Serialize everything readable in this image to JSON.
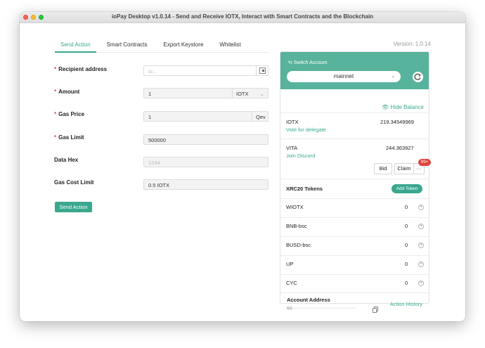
{
  "window": {
    "title": "ioPay Desktop v1.0.14 - Send and Receive IOTX, Interact with Smart Contracts and the Blockchain"
  },
  "tabs": [
    "Send Action",
    "Smart Contracts",
    "Export Keystore",
    "Whitelist"
  ],
  "version": "Version: 1.0.14",
  "form": {
    "recipient": {
      "label": "Recipient address",
      "placeholder": "io..."
    },
    "amount": {
      "label": "Amount",
      "value": "1",
      "unit": "IOTX"
    },
    "gas_price": {
      "label": "Gas Price",
      "value": "1",
      "unit": "Qev"
    },
    "gas_limit": {
      "label": "Gas Limit",
      "value": "500000"
    },
    "data_hex": {
      "label": "Data Hex",
      "placeholder": "1234"
    },
    "gas_cost": {
      "label": "Gas Cost Limit",
      "value": "0.5 IOTX"
    },
    "required_mark": "*",
    "send_label": "Send Action"
  },
  "account": {
    "switch_label": "Switch Account",
    "network": "mainnet",
    "hide_balance": "Hide Balance",
    "iotx": {
      "name": "IOTX",
      "value": "219.34549969",
      "link": "Vote for delegate"
    },
    "vita": {
      "name": "VITA",
      "value": "244.363927",
      "link": "Join Discord"
    },
    "bid": "Bid",
    "claim": "Claim",
    "more": "···",
    "badge": "99+",
    "xrc_title": "XRC20 Tokens",
    "add_token": "Add Token",
    "tokens": [
      {
        "name": "WIOTX",
        "value": "0"
      },
      {
        "name": "BNB-bsc",
        "value": "0"
      },
      {
        "name": "BUSD-bsc",
        "value": "0"
      },
      {
        "name": "UP",
        "value": "0"
      },
      {
        "name": "CYC",
        "value": "0"
      }
    ],
    "address_title": "Account Address",
    "address": "io1·············································",
    "history": "Action History"
  },
  "colors": {
    "accent": "#3aa88f",
    "header": "#57b39b",
    "badge": "#e0433c"
  }
}
